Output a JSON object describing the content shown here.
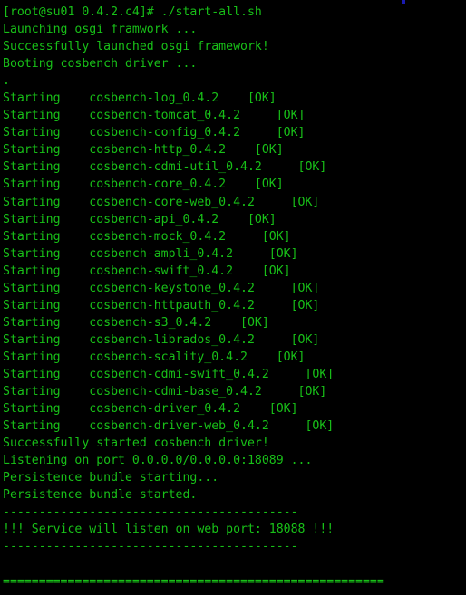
{
  "terminal": {
    "colors": {
      "background": "#000000",
      "foreground": "#18c018",
      "cursor_artifact": "#1a1ab0"
    },
    "prompt": {
      "user": "root",
      "host": "su01",
      "directory": "0.4.2.c4",
      "symbol": "#",
      "command": "./start-all.sh",
      "full_line": "[root@su01 0.4.2.c4]# ./start-all.sh"
    },
    "lines": [
      "[root@su01 0.4.2.c4]# ./start-all.sh",
      "Launching osgi framwork ...",
      "Successfully launched osgi framework!",
      "Booting cosbench driver ...",
      ".",
      "Starting    cosbench-log_0.4.2    [OK]",
      "Starting    cosbench-tomcat_0.4.2     [OK]",
      "Starting    cosbench-config_0.4.2     [OK]",
      "Starting    cosbench-http_0.4.2    [OK]",
      "Starting    cosbench-cdmi-util_0.4.2     [OK]",
      "Starting    cosbench-core_0.4.2    [OK]",
      "Starting    cosbench-core-web_0.4.2     [OK]",
      "Starting    cosbench-api_0.4.2    [OK]",
      "Starting    cosbench-mock_0.4.2     [OK]",
      "Starting    cosbench-ampli_0.4.2     [OK]",
      "Starting    cosbench-swift_0.4.2    [OK]",
      "Starting    cosbench-keystone_0.4.2     [OK]",
      "Starting    cosbench-httpauth_0.4.2     [OK]",
      "Starting    cosbench-s3_0.4.2    [OK]",
      "Starting    cosbench-librados_0.4.2     [OK]",
      "Starting    cosbench-scality_0.4.2    [OK]",
      "Starting    cosbench-cdmi-swift_0.4.2     [OK]",
      "Starting    cosbench-cdmi-base_0.4.2     [OK]",
      "Starting    cosbench-driver_0.4.2    [OK]",
      "Starting    cosbench-driver-web_0.4.2     [OK]",
      "Successfully started cosbench driver!",
      "Listening on port 0.0.0.0/0.0.0.0:18089 ...",
      "Persistence bundle starting...",
      "Persistence bundle started.",
      "-----------------------------------------",
      "!!! Service will listen on web port: 18088 !!!",
      "-----------------------------------------",
      "",
      "====================================================="
    ],
    "services": [
      {
        "action": "Starting",
        "name": "cosbench-log_0.4.2",
        "status": "[OK]"
      },
      {
        "action": "Starting",
        "name": "cosbench-tomcat_0.4.2",
        "status": "[OK]"
      },
      {
        "action": "Starting",
        "name": "cosbench-config_0.4.2",
        "status": "[OK]"
      },
      {
        "action": "Starting",
        "name": "cosbench-http_0.4.2",
        "status": "[OK]"
      },
      {
        "action": "Starting",
        "name": "cosbench-cdmi-util_0.4.2",
        "status": "[OK]"
      },
      {
        "action": "Starting",
        "name": "cosbench-core_0.4.2",
        "status": "[OK]"
      },
      {
        "action": "Starting",
        "name": "cosbench-core-web_0.4.2",
        "status": "[OK]"
      },
      {
        "action": "Starting",
        "name": "cosbench-api_0.4.2",
        "status": "[OK]"
      },
      {
        "action": "Starting",
        "name": "cosbench-mock_0.4.2",
        "status": "[OK]"
      },
      {
        "action": "Starting",
        "name": "cosbench-ampli_0.4.2",
        "status": "[OK]"
      },
      {
        "action": "Starting",
        "name": "cosbench-swift_0.4.2",
        "status": "[OK]"
      },
      {
        "action": "Starting",
        "name": "cosbench-keystone_0.4.2",
        "status": "[OK]"
      },
      {
        "action": "Starting",
        "name": "cosbench-httpauth_0.4.2",
        "status": "[OK]"
      },
      {
        "action": "Starting",
        "name": "cosbench-s3_0.4.2",
        "status": "[OK]"
      },
      {
        "action": "Starting",
        "name": "cosbench-librados_0.4.2",
        "status": "[OK]"
      },
      {
        "action": "Starting",
        "name": "cosbench-scality_0.4.2",
        "status": "[OK]"
      },
      {
        "action": "Starting",
        "name": "cosbench-cdmi-swift_0.4.2",
        "status": "[OK]"
      },
      {
        "action": "Starting",
        "name": "cosbench-cdmi-base_0.4.2",
        "status": "[OK]"
      },
      {
        "action": "Starting",
        "name": "cosbench-driver_0.4.2",
        "status": "[OK]"
      },
      {
        "action": "Starting",
        "name": "cosbench-driver-web_0.4.2",
        "status": "[OK]"
      }
    ],
    "status_messages": {
      "launching": "Launching osgi framwork ...",
      "launched": "Successfully launched osgi framework!",
      "booting": "Booting cosbench driver ...",
      "progress_dot": ".",
      "driver_started": "Successfully started cosbench driver!",
      "listening": "Listening on port 0.0.0.0/0.0.0.0:18089 ...",
      "persistence_starting": "Persistence bundle starting...",
      "persistence_started": "Persistence bundle started.",
      "web_port_banner": "!!! Service will listen on web port: 18088 !!!"
    },
    "ports": {
      "driver_port": "18089",
      "web_port": "18088",
      "bind_address": "0.0.0.0/0.0.0.0"
    }
  }
}
